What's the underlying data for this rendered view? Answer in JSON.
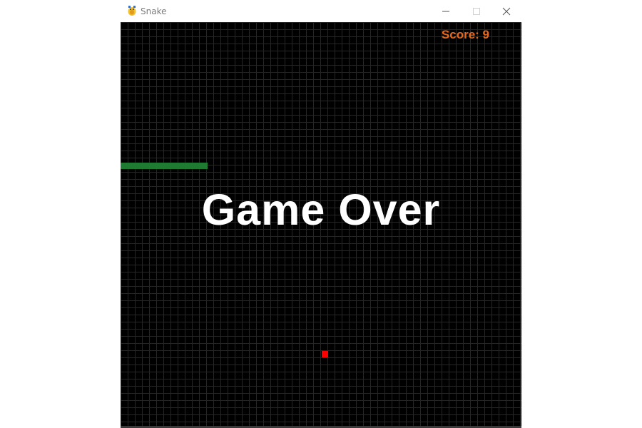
{
  "window": {
    "title": "Snake",
    "app_icon": "pygame-snake-icon",
    "controls": [
      "minimize-icon",
      "maximize-icon",
      "close-icon"
    ]
  },
  "game": {
    "score_text": "Score: 9",
    "status_text": "Game Over",
    "colors": {
      "background": "#000000",
      "grid": "#262626",
      "snake": "#1f7a32",
      "food": "#ff0000",
      "score": "#e8681a",
      "message": "#ffffff"
    }
  }
}
